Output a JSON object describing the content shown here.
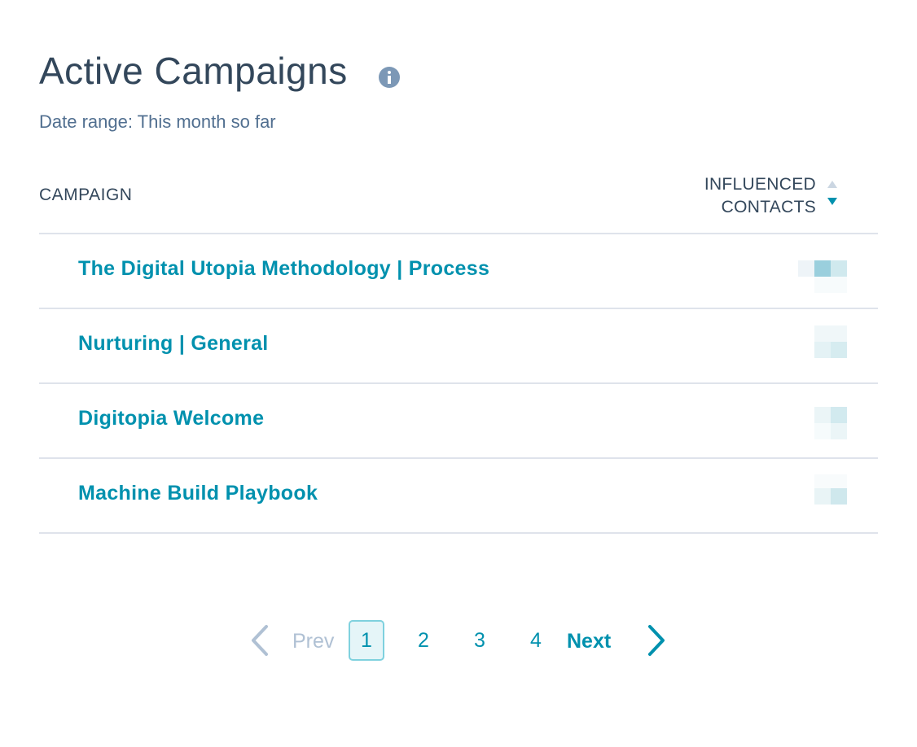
{
  "header": {
    "title": "Active Campaigns",
    "info_icon": "info-icon",
    "date_range": "Date range: This month so far"
  },
  "table": {
    "columns": [
      {
        "label": "CAMPAIGN"
      },
      {
        "label": "INFLUENCED CONTACTS",
        "line1": "INFLUENCED",
        "line2": "CONTACTS",
        "sort": "descending"
      }
    ],
    "rows": [
      {
        "campaign": "The Digital Utopia Methodology | Process",
        "influenced_contacts": "(obscured)"
      },
      {
        "campaign": "Nurturing | General",
        "influenced_contacts": "(obscured)"
      },
      {
        "campaign": "Digitopia Welcome",
        "influenced_contacts": "(obscured)"
      },
      {
        "campaign": "Machine Build Playbook",
        "influenced_contacts": "(obscured)"
      }
    ]
  },
  "pagination": {
    "prev_label": "Prev",
    "next_label": "Next",
    "pages": [
      "1",
      "2",
      "3",
      "4"
    ],
    "current_page": "1"
  },
  "colors": {
    "accent": "#0091ae",
    "heading": "#33475b",
    "muted": "#516f90",
    "disabled": "#b0c1d4",
    "divider": "#dfe3eb"
  }
}
